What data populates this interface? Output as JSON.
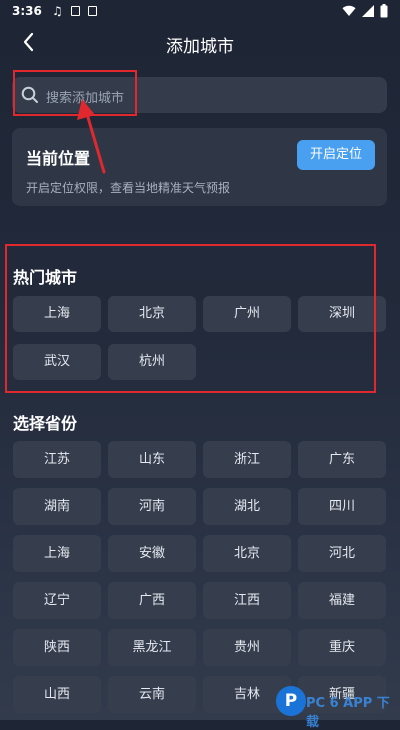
{
  "status_bar": {
    "time": "3:36"
  },
  "header": {
    "title": "添加城市"
  },
  "search": {
    "placeholder": "搜索添加城市"
  },
  "location": {
    "title": "当前位置",
    "button": "开启定位",
    "description": "开启定位权限，查看当地精准天气预报"
  },
  "hot_cities": {
    "title": "热门城市",
    "items": [
      "上海",
      "北京",
      "广州",
      "深圳",
      "武汉",
      "杭州"
    ]
  },
  "provinces": {
    "title": "选择省份",
    "items": [
      "江苏",
      "山东",
      "浙江",
      "广东",
      "湖南",
      "河南",
      "湖北",
      "四川",
      "上海",
      "安徽",
      "北京",
      "河北",
      "辽宁",
      "广西",
      "江西",
      "福建",
      "陕西",
      "黑龙江",
      "贵州",
      "重庆",
      "山西",
      "云南",
      "吉林",
      "新疆"
    ]
  },
  "watermark": {
    "letter": "P",
    "text": "PC 6 APP 下载"
  },
  "colors": {
    "accent": "#4aa0f0",
    "annotation_red": "#e0282e"
  }
}
